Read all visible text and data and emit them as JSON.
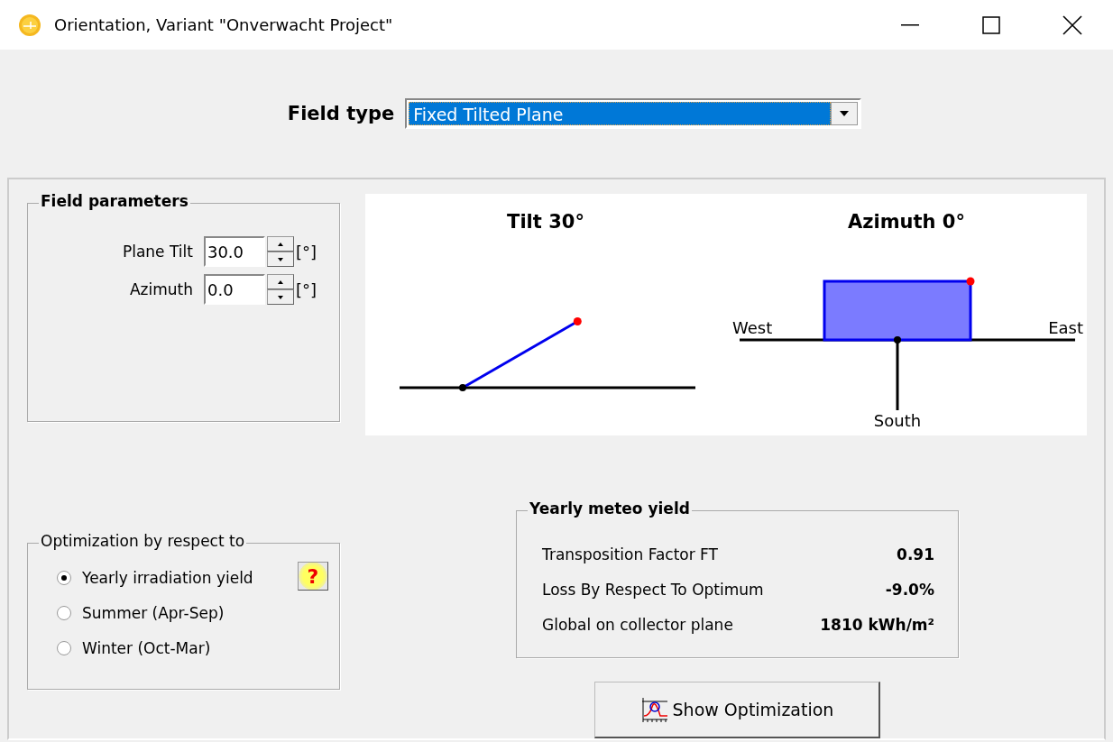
{
  "window": {
    "title": "Orientation, Variant \"Onverwacht Project\""
  },
  "field_type": {
    "label": "Field type",
    "value": "Fixed Tilted Plane"
  },
  "field_parameters": {
    "title": "Field parameters",
    "rows": [
      {
        "label": "Plane Tilt",
        "value": "30.0",
        "unit": "[°]"
      },
      {
        "label": "Azimuth",
        "value": "0.0",
        "unit": "[°]"
      }
    ]
  },
  "diagram": {
    "tilt_title": "Tilt 30°",
    "azimuth_title": "Azimuth 0°",
    "west": "West",
    "east": "East",
    "south": "South"
  },
  "optimization": {
    "title": "Optimization by respect to",
    "help": "?",
    "options": [
      {
        "label": "Yearly irradiation yield",
        "selected": true
      },
      {
        "label": "Summer (Apr-Sep)",
        "selected": false
      },
      {
        "label": "Winter (Oct-Mar)",
        "selected": false
      }
    ]
  },
  "yearly_meteo_yield": {
    "title": "Yearly meteo yield",
    "rows": [
      {
        "label": "Transposition Factor FT",
        "value": "0.91"
      },
      {
        "label": "Loss By Respect To Optimum",
        "value": "-9.0%"
      },
      {
        "label": "Global on collector plane",
        "value": "1810 kWh/m²"
      }
    ]
  },
  "show_optimization_button": "Show Optimization"
}
